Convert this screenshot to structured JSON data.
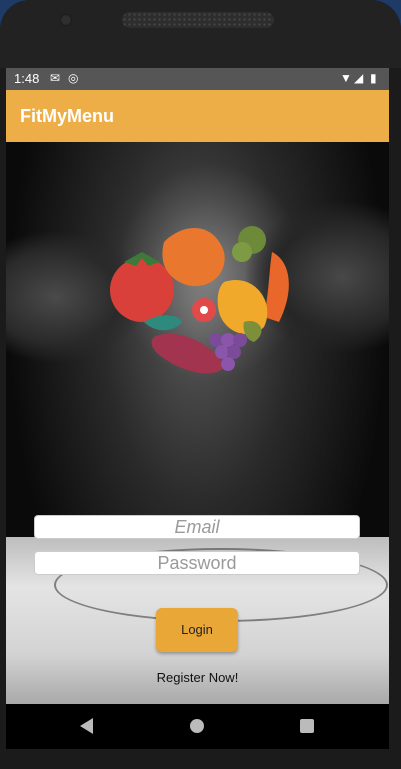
{
  "status_bar": {
    "time": "1:48",
    "icons": [
      "mail-icon",
      "sync-icon",
      "wifi-icon",
      "signal-icon",
      "battery-icon"
    ]
  },
  "app_bar": {
    "title": "FitMyMenu",
    "color": "#edae47"
  },
  "login": {
    "email_placeholder": "Email",
    "password_placeholder": "Password",
    "login_label": "Login",
    "register_label": "Register Now!"
  },
  "nav": {
    "icons": [
      "back-icon",
      "home-icon",
      "recent-apps-icon"
    ]
  },
  "colors": {
    "accent": "#edae47",
    "button": "#e8a737"
  }
}
